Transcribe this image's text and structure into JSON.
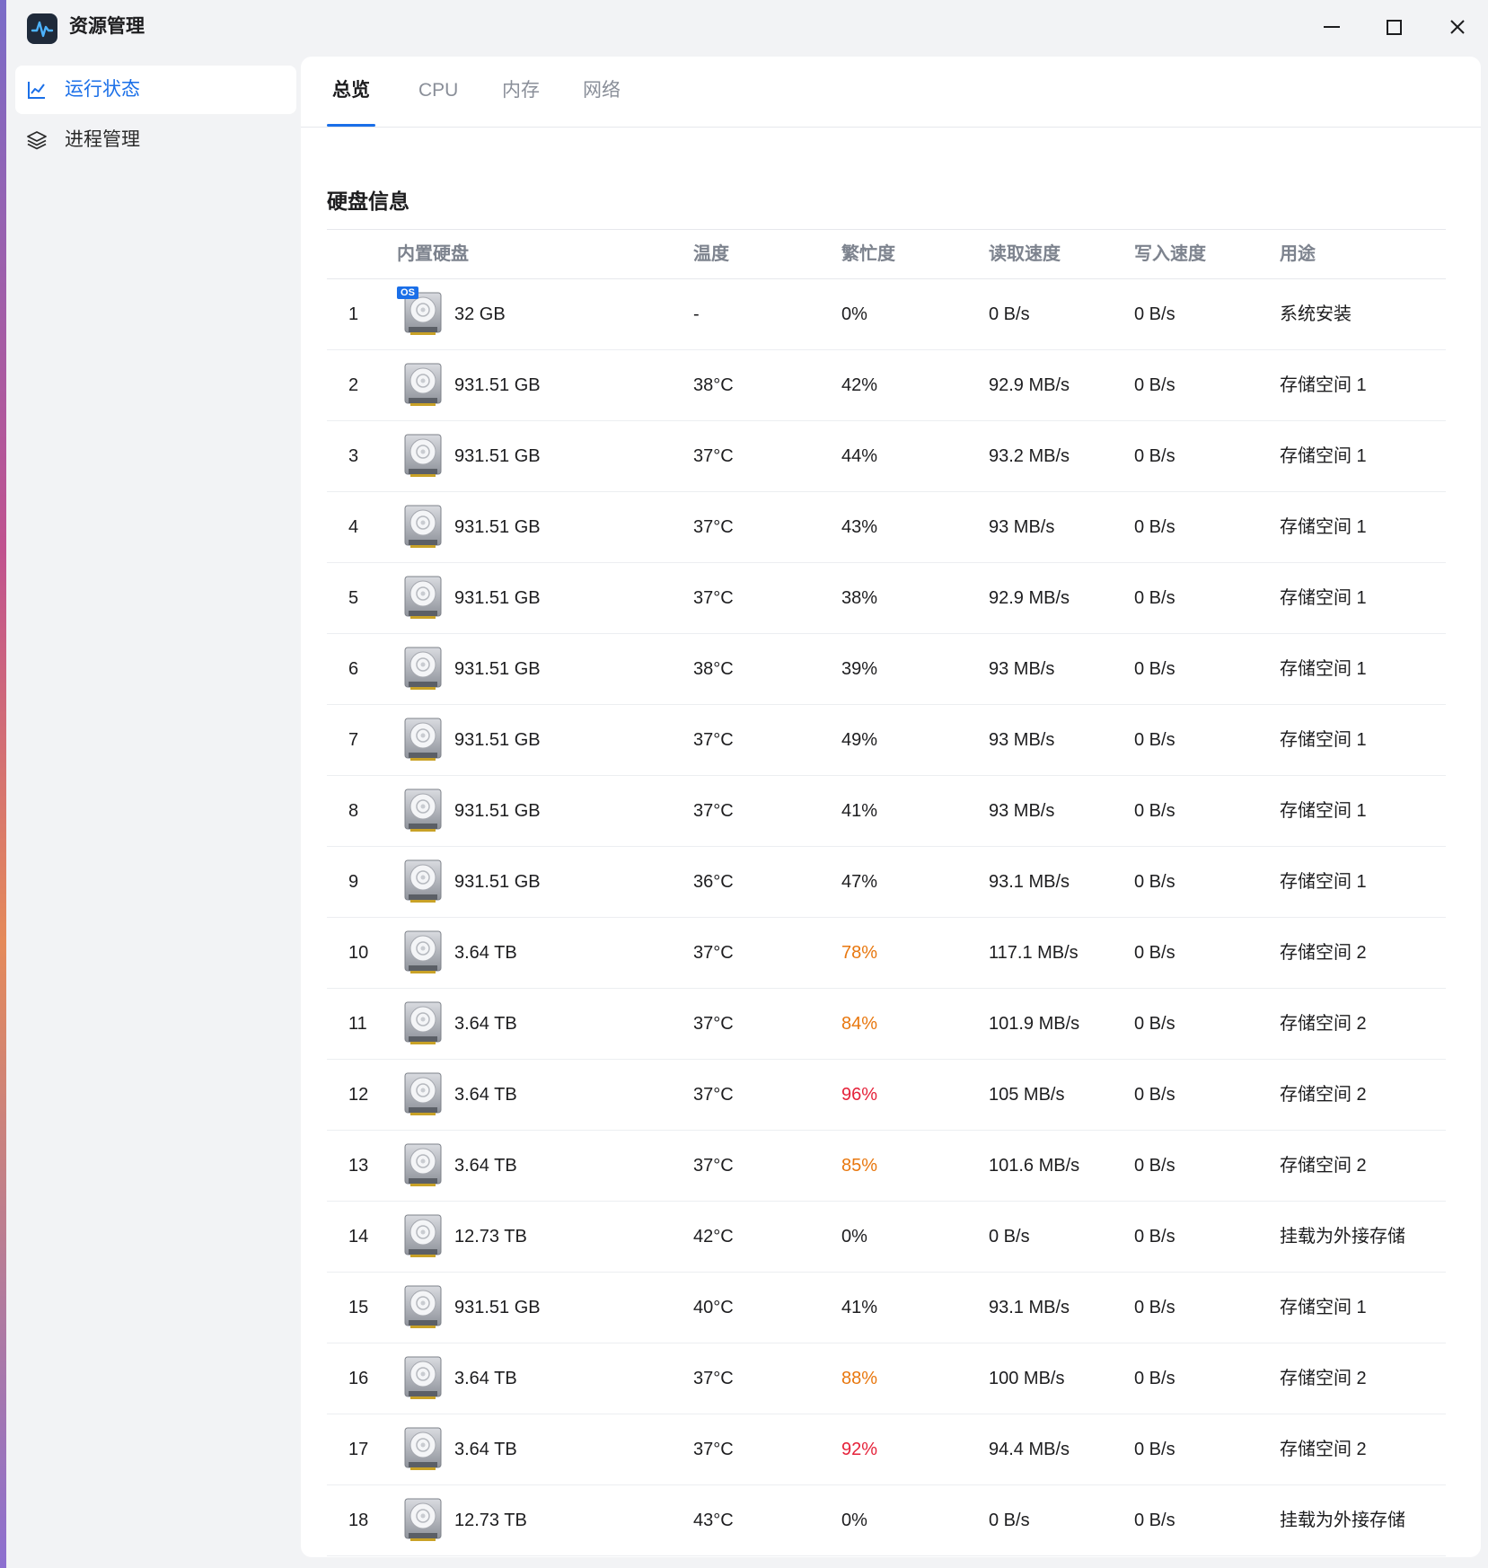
{
  "window": {
    "title": "资源管理"
  },
  "sidebar": {
    "items": [
      {
        "label": "运行状态",
        "icon": "line-chart-icon",
        "active": true
      },
      {
        "label": "进程管理",
        "icon": "layers-icon",
        "active": false
      }
    ]
  },
  "tabs": [
    {
      "label": "总览",
      "active": true
    },
    {
      "label": "CPU",
      "active": false
    },
    {
      "label": "内存",
      "active": false
    },
    {
      "label": "网络",
      "active": false
    }
  ],
  "section": {
    "title": "硬盘信息"
  },
  "table": {
    "headers": {
      "disk": "内置硬盘",
      "temp": "温度",
      "busy": "繁忙度",
      "read": "读取速度",
      "write": "写入速度",
      "usage": "用途"
    },
    "os_badge": "OS",
    "rows": [
      {
        "idx": "1",
        "size": "32 GB",
        "temp": "-",
        "busy": "0%",
        "read": "0 B/s",
        "write": "0 B/s",
        "usage": "系统安装",
        "level": "normal",
        "os": true
      },
      {
        "idx": "2",
        "size": "931.51 GB",
        "temp": "38°C",
        "busy": "42%",
        "read": "92.9 MB/s",
        "write": "0 B/s",
        "usage": "存储空间 1",
        "level": "normal"
      },
      {
        "idx": "3",
        "size": "931.51 GB",
        "temp": "37°C",
        "busy": "44%",
        "read": "93.2 MB/s",
        "write": "0 B/s",
        "usage": "存储空间 1",
        "level": "normal"
      },
      {
        "idx": "4",
        "size": "931.51 GB",
        "temp": "37°C",
        "busy": "43%",
        "read": "93 MB/s",
        "write": "0 B/s",
        "usage": "存储空间 1",
        "level": "normal"
      },
      {
        "idx": "5",
        "size": "931.51 GB",
        "temp": "37°C",
        "busy": "38%",
        "read": "92.9 MB/s",
        "write": "0 B/s",
        "usage": "存储空间 1",
        "level": "normal"
      },
      {
        "idx": "6",
        "size": "931.51 GB",
        "temp": "38°C",
        "busy": "39%",
        "read": "93 MB/s",
        "write": "0 B/s",
        "usage": "存储空间 1",
        "level": "normal"
      },
      {
        "idx": "7",
        "size": "931.51 GB",
        "temp": "37°C",
        "busy": "49%",
        "read": "93 MB/s",
        "write": "0 B/s",
        "usage": "存储空间 1",
        "level": "normal"
      },
      {
        "idx": "8",
        "size": "931.51 GB",
        "temp": "37°C",
        "busy": "41%",
        "read": "93 MB/s",
        "write": "0 B/s",
        "usage": "存储空间 1",
        "level": "normal"
      },
      {
        "idx": "9",
        "size": "931.51 GB",
        "temp": "36°C",
        "busy": "47%",
        "read": "93.1 MB/s",
        "write": "0 B/s",
        "usage": "存储空间 1",
        "level": "normal"
      },
      {
        "idx": "10",
        "size": "3.64 TB",
        "temp": "37°C",
        "busy": "78%",
        "read": "117.1 MB/s",
        "write": "0 B/s",
        "usage": "存储空间 2",
        "level": "warn"
      },
      {
        "idx": "11",
        "size": "3.64 TB",
        "temp": "37°C",
        "busy": "84%",
        "read": "101.9 MB/s",
        "write": "0 B/s",
        "usage": "存储空间 2",
        "level": "warn"
      },
      {
        "idx": "12",
        "size": "3.64 TB",
        "temp": "37°C",
        "busy": "96%",
        "read": "105 MB/s",
        "write": "0 B/s",
        "usage": "存储空间 2",
        "level": "crit"
      },
      {
        "idx": "13",
        "size": "3.64 TB",
        "temp": "37°C",
        "busy": "85%",
        "read": "101.6 MB/s",
        "write": "0 B/s",
        "usage": "存储空间 2",
        "level": "warn"
      },
      {
        "idx": "14",
        "size": "12.73 TB",
        "temp": "42°C",
        "busy": "0%",
        "read": "0 B/s",
        "write": "0 B/s",
        "usage": "挂载为外接存储",
        "level": "normal"
      },
      {
        "idx": "15",
        "size": "931.51 GB",
        "temp": "40°C",
        "busy": "41%",
        "read": "93.1 MB/s",
        "write": "0 B/s",
        "usage": "存储空间 1",
        "level": "normal"
      },
      {
        "idx": "16",
        "size": "3.64 TB",
        "temp": "37°C",
        "busy": "88%",
        "read": "100 MB/s",
        "write": "0 B/s",
        "usage": "存储空间 2",
        "level": "warn"
      },
      {
        "idx": "17",
        "size": "3.64 TB",
        "temp": "37°C",
        "busy": "92%",
        "read": "94.4 MB/s",
        "write": "0 B/s",
        "usage": "存储空间 2",
        "level": "crit"
      },
      {
        "idx": "18",
        "size": "12.73 TB",
        "temp": "43°C",
        "busy": "0%",
        "read": "0 B/s",
        "write": "0 B/s",
        "usage": "挂载为外接存储",
        "level": "normal"
      }
    ]
  },
  "colors": {
    "accent": "#1a6fe8",
    "warn": "#e8770e",
    "crit": "#e5223a"
  }
}
